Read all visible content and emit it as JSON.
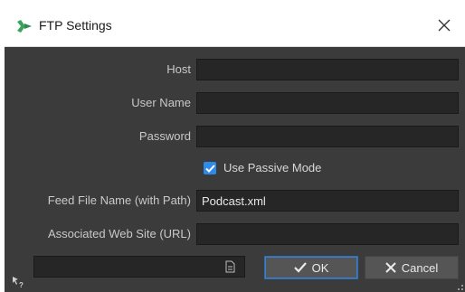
{
  "window": {
    "title": "FTP Settings"
  },
  "form": {
    "host_label": "Host",
    "host_value": "",
    "username_label": "User Name",
    "username_value": "",
    "password_label": "Password",
    "password_value": "",
    "passive_label": "Use Passive Mode",
    "passive_checked": true,
    "feed_label": "Feed File Name (with Path)",
    "feed_value": "Podcast.xml",
    "website_label": "Associated Web Site (URL)",
    "website_value": ""
  },
  "footer": {
    "path_value": "",
    "ok_label": "OK",
    "cancel_label": "Cancel"
  },
  "colors": {
    "accent": "#2d8ae6",
    "background": "#3b3b3b",
    "field_bg": "#262626",
    "button_bg": "#555555"
  },
  "icons": {
    "app": "app-logo-icon",
    "close": "close-icon",
    "check": "checkmark-icon",
    "ok": "checkmark-icon",
    "cancel": "x-icon",
    "path_action": "document-icon",
    "help": "help-arrow-icon"
  }
}
